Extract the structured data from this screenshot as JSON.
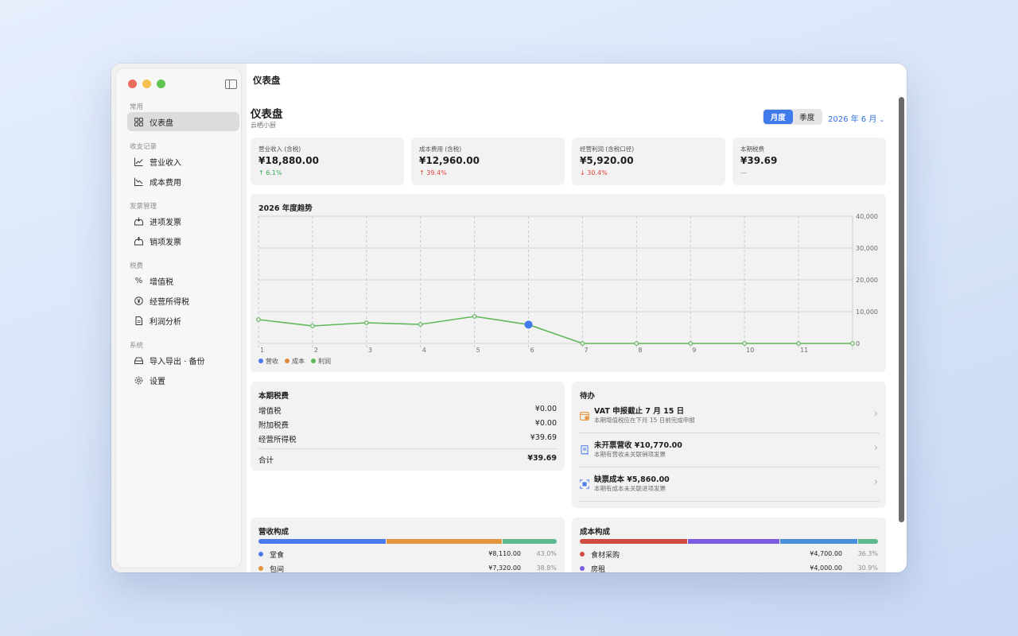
{
  "app": {
    "topbar_title": "仪表盘"
  },
  "sidebar": {
    "sections": [
      "常用",
      "收支记录",
      "发票管理",
      "税费",
      "系统"
    ],
    "items": [
      {
        "label": "仪表盘",
        "icon": "grid-icon"
      },
      {
        "label": "营业收入",
        "icon": "trend-up-icon"
      },
      {
        "label": "成本费用",
        "icon": "trend-down-icon"
      },
      {
        "label": "进项发票",
        "icon": "tray-in-icon"
      },
      {
        "label": "销项发票",
        "icon": "tray-out-icon"
      },
      {
        "label": "增值税",
        "icon": "percent-icon"
      },
      {
        "label": "经营所得税",
        "icon": "yen-circle-icon"
      },
      {
        "label": "利润分析",
        "icon": "document-icon"
      },
      {
        "label": "导入导出 · 备份",
        "icon": "drive-icon"
      },
      {
        "label": "设置",
        "icon": "gear-icon"
      }
    ]
  },
  "header": {
    "title": "仪表盘",
    "subtitle": "云栖小厨",
    "period_tabs": [
      "月度",
      "季度"
    ],
    "active_tab": "月度",
    "month_label": "2026 年 6 月"
  },
  "kpis": [
    {
      "label": "营业收入 (含税)",
      "value": "¥18,880.00",
      "change": "6.1%",
      "arrow": "↑"
    },
    {
      "label": "成本费用 (含税)",
      "value": "¥12,960.00",
      "change": "39.4%",
      "arrow": "↑"
    },
    {
      "label": "经营利润 (含税口径)",
      "value": "¥5,920.00",
      "change": "30.4%",
      "arrow": "↓"
    },
    {
      "label": "本期税费",
      "value": "¥39.69",
      "change": "—",
      "arrow": ""
    }
  ],
  "chart_data": {
    "type": "line",
    "title": "2026 年度趋势",
    "x": [
      1,
      2,
      3,
      4,
      5,
      6,
      7,
      8,
      9,
      10,
      11,
      12
    ],
    "x_tick_labels": [
      "1",
      "2",
      "3",
      "4",
      "5",
      "6",
      "7",
      "8",
      "9",
      "10",
      "11"
    ],
    "series": [
      {
        "name": "营收",
        "color": "#4a7bea",
        "values": []
      },
      {
        "name": "成本",
        "color": "#e08a3c",
        "values": []
      },
      {
        "name": "利润",
        "color": "#5fb85a",
        "values": [
          7500,
          5500,
          6500,
          6000,
          8500,
          5920,
          0,
          0,
          0,
          0,
          0,
          0
        ]
      }
    ],
    "highlight": {
      "x": 6,
      "value": 5920,
      "color": "#3f7bea"
    },
    "ylim": [
      0,
      40000
    ],
    "y_ticks": [
      "40,000",
      "30,000",
      "20,000",
      "10,000",
      "0"
    ],
    "legend_position": "bottom-left",
    "grid": true
  },
  "tax": {
    "title": "本期税费",
    "rows": [
      {
        "label": "增值税",
        "value": "¥0.00"
      },
      {
        "label": "附加税费",
        "value": "¥0.00"
      },
      {
        "label": "经营所得税",
        "value": "¥39.69"
      }
    ],
    "total_label": "合计",
    "total_value": "¥39.69"
  },
  "todo": {
    "title": "待办",
    "items": [
      {
        "title": "VAT 申报截止 7 月 15 日",
        "sub": "本期增值税应在下月 15 日前完成申报",
        "icon": "calendar-icon",
        "color": "#e8913a"
      },
      {
        "title": "未开票营收 ¥10,770.00",
        "sub": "本期有营收未关联销项发票",
        "icon": "receipt-icon",
        "color": "#4a7bea"
      },
      {
        "title": "缺票成本 ¥5,860.00",
        "sub": "本期有成本未关联进项发票",
        "icon": "scan-icon",
        "color": "#4a7bea"
      }
    ]
  },
  "revenue_comp": {
    "title": "营收构成",
    "segments": [
      {
        "name": "堂食",
        "amount": "¥8,110.00",
        "pct": "43.0%",
        "share": 43.0,
        "color": "#4a7bea"
      },
      {
        "name": "包间",
        "amount": "¥7,320.00",
        "pct": "38.8%",
        "share": 38.8,
        "color": "#e3963e"
      },
      {
        "name": "",
        "amount": "",
        "pct": "",
        "share": 18.2,
        "color": "#5db88f"
      }
    ]
  },
  "cost_comp": {
    "title": "成本构成",
    "segments": [
      {
        "name": "食材采购",
        "amount": "¥4,700.00",
        "pct": "36.3%",
        "share": 36.3,
        "color": "#cf4a41"
      },
      {
        "name": "房租",
        "amount": "¥4,000.00",
        "pct": "30.9%",
        "share": 30.9,
        "color": "#7b5be0"
      },
      {
        "name": "",
        "amount": "",
        "pct": "",
        "share": 26.0,
        "color": "#4a8fd9"
      },
      {
        "name": "",
        "amount": "",
        "pct": "",
        "share": 6.8,
        "color": "#5db88f"
      }
    ]
  }
}
